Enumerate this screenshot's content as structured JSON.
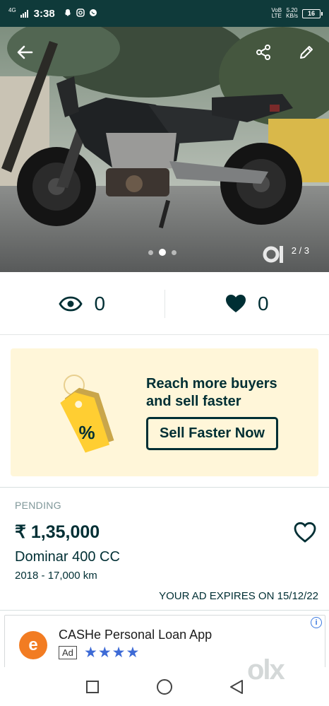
{
  "status_bar": {
    "network": "4G",
    "time": "3:38",
    "volte": "VoB",
    "lte": "LTE",
    "speed_value": "5.20",
    "speed_unit": "KB/s",
    "battery": "16"
  },
  "gallery": {
    "counter": "2 / 3",
    "current_index": 2,
    "total": 3,
    "watermark": "olx",
    "icons": {
      "back": "arrow-left-icon",
      "share": "share-icon",
      "edit": "pencil-icon"
    }
  },
  "stats": {
    "views": "0",
    "likes": "0",
    "icons": {
      "views": "eye-icon",
      "likes": "heart-icon"
    }
  },
  "promo": {
    "line1": "Reach more buyers",
    "line2": "and sell faster",
    "button_label": "Sell Faster Now",
    "tag_symbol": "%",
    "bg_color": "#fff6d9",
    "tag_color": "#ffce32"
  },
  "listing": {
    "status": "PENDING",
    "price": "₹ 1,35,000",
    "title": "Dominar 400 CC",
    "meta": "2018 - 17,000 km",
    "expiry": "YOUR AD EXPIRES ON 15/12/22"
  },
  "ad": {
    "logo_letter": "e",
    "title": "CASHe Personal Loan App",
    "badge": "Ad",
    "stars": "★★★★",
    "info": "i"
  },
  "watermark": "olx",
  "colors": {
    "primary": "#002f34",
    "status_bar": "#0f3a3a",
    "muted": "#7f9799"
  }
}
